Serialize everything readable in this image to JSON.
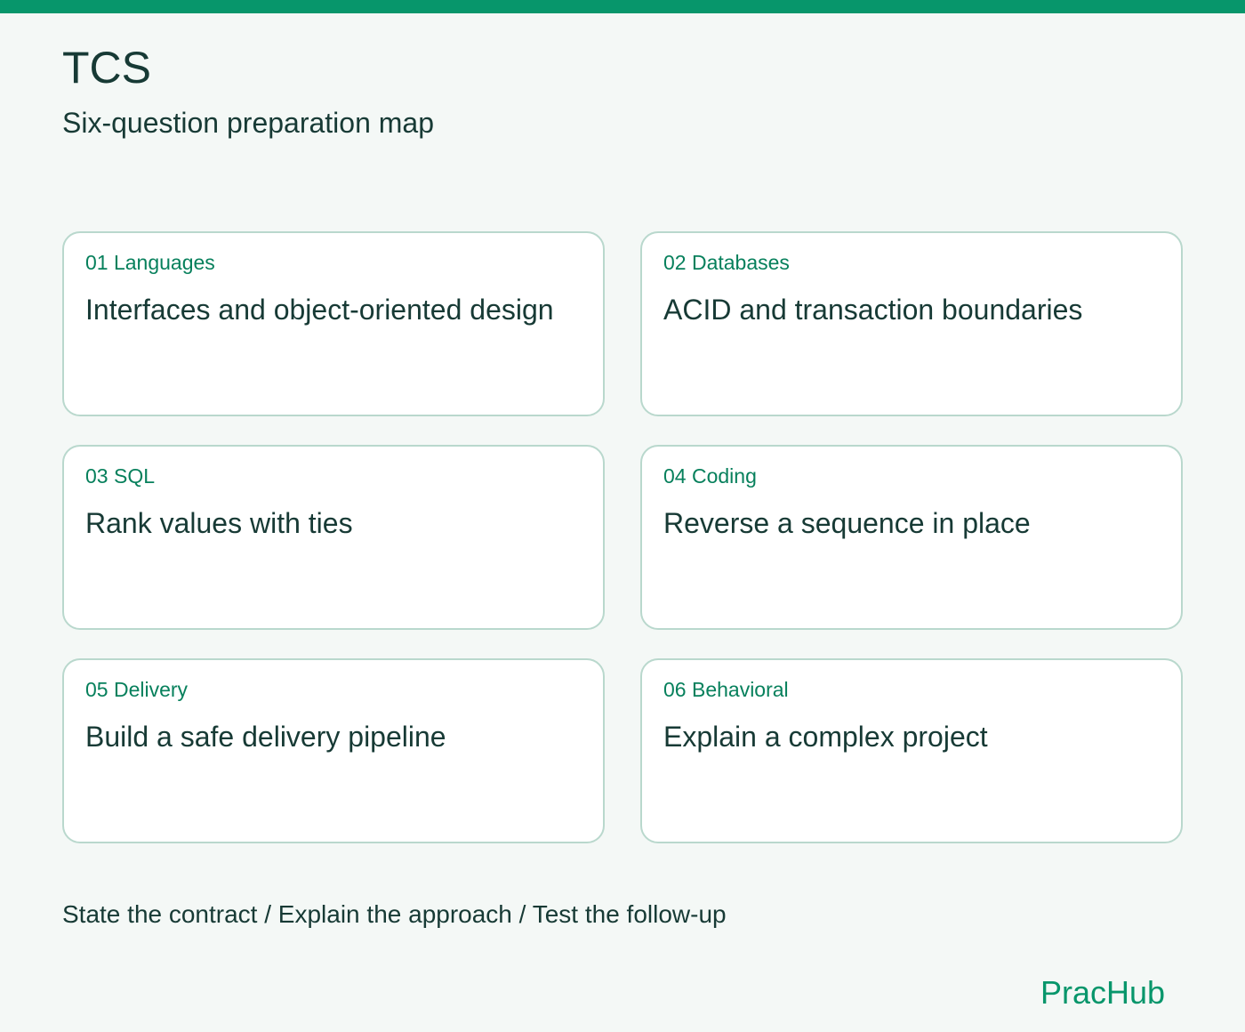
{
  "colors": {
    "accent": "#07966b",
    "text": "#173a35",
    "tag": "#07805c",
    "card_border": "#b9d8cd",
    "background": "#f4f8f6"
  },
  "header": {
    "title": "TCS",
    "subtitle": "Six-question preparation map"
  },
  "cards": [
    {
      "tag": "01 Languages",
      "heading": "Interfaces and object-oriented design"
    },
    {
      "tag": "02 Databases",
      "heading": "ACID and transaction boundaries"
    },
    {
      "tag": "03 SQL",
      "heading": "Rank values with ties"
    },
    {
      "tag": "04 Coding",
      "heading": "Reverse a sequence in place"
    },
    {
      "tag": "05 Delivery",
      "heading": "Build a safe delivery pipeline"
    },
    {
      "tag": "06 Behavioral",
      "heading": "Explain a complex project"
    }
  ],
  "footer": {
    "note": "State the contract / Explain the approach / Test the follow-up",
    "brand": "PracHub"
  }
}
